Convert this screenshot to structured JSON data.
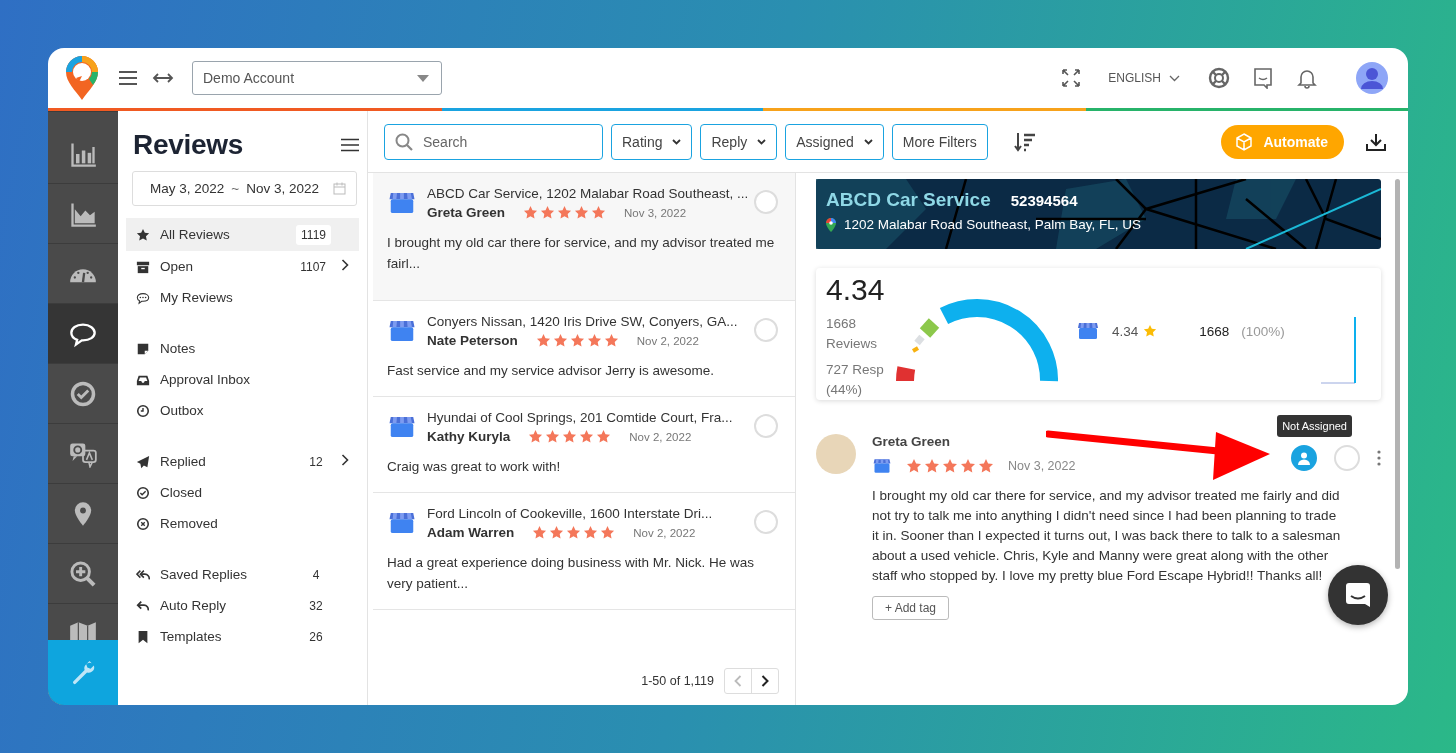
{
  "header": {
    "account_select": "Demo Account",
    "language": "ENGLISH"
  },
  "rail": [
    {
      "selected": false
    },
    {
      "selected": false
    },
    {
      "selected": false
    },
    {
      "selected": true
    },
    {
      "selected": false
    },
    {
      "selected": false
    },
    {
      "selected": false
    },
    {
      "selected": false
    },
    {
      "selected": false
    }
  ],
  "rail_footer": {
    "selected": true
  },
  "sidebar": {
    "title": "Reviews",
    "date_range": {
      "start": "May 3, 2022",
      "separator": "~",
      "end": "Nov 3, 2022"
    },
    "groups": [
      {
        "items": [
          {
            "label": "All Reviews",
            "count": "1119",
            "selected": true,
            "expandable": false
          },
          {
            "label": "Open",
            "count": "1107",
            "selected": false,
            "expandable": true
          },
          {
            "label": "My Reviews",
            "selected": false,
            "expandable": false
          }
        ]
      },
      {
        "items": [
          {
            "label": "Notes",
            "selected": false,
            "expandable": false
          },
          {
            "label": "Approval Inbox",
            "selected": false,
            "expandable": false
          },
          {
            "label": "Outbox",
            "selected": false,
            "expandable": false
          }
        ]
      },
      {
        "items": [
          {
            "label": "Replied",
            "count": "12",
            "selected": false,
            "expandable": true
          },
          {
            "label": "Closed",
            "selected": false,
            "expandable": false
          },
          {
            "label": "Removed",
            "selected": false,
            "expandable": false
          }
        ]
      },
      {
        "items": [
          {
            "label": "Saved Replies",
            "count": "4",
            "selected": false,
            "expandable": false
          },
          {
            "label": "Auto Reply",
            "count": "32",
            "selected": false,
            "expandable": false
          },
          {
            "label": "Templates",
            "count": "26",
            "selected": false,
            "expandable": false
          }
        ]
      }
    ]
  },
  "toolbar": {
    "search": {
      "placeholder": "Search"
    },
    "dropdowns": [
      "Rating",
      "Reply",
      "Assigned"
    ],
    "more_filters": "More Filters",
    "automate": "Automate"
  },
  "reviews": [
    {
      "location": "ABCD Car Service, 1202 Malabar Road Southeast, ...",
      "author": "Greta Green",
      "stars": 5,
      "date": "Nov 3, 2022",
      "excerpt": "I brought my old car there for service, and my advisor treated me fairl...",
      "selected": true,
      "checked": false
    },
    {
      "location": "Conyers Nissan, 1420 Iris Drive SW, Conyers, GA...",
      "author": "Nate Peterson",
      "stars": 5,
      "date": "Nov 2, 2022",
      "excerpt": "Fast service and my service advisor Jerry is awesome.",
      "selected": false,
      "checked": false
    },
    {
      "location": "Hyundai of Cool Springs, 201 Comtide Court, Fra...",
      "author": "Kathy Kuryla",
      "stars": 5,
      "date": "Nov 2, 2022",
      "excerpt": "Craig was great to work with!",
      "selected": false,
      "checked": false
    },
    {
      "location": "Ford Lincoln of Cookeville, 1600 Interstate Dri...",
      "author": "Adam Warren",
      "stars": 5,
      "date": "Nov 2, 2022",
      "excerpt": "Had a great experience doing business with Mr. Nick. He was very patient...",
      "selected": false,
      "checked": false
    }
  ],
  "pagination": {
    "range": "1-50 of 1,119"
  },
  "detail": {
    "business": {
      "name": "ABCD Car Service",
      "id": "52394564",
      "address": "1202 Malabar Road Southeast, Palm Bay, FL, US"
    },
    "stats": {
      "rating": "4.34",
      "review_count": "1668",
      "review_label": "Reviews",
      "responses": "727 Resp",
      "response_share": "(44%)",
      "source_rating": "4.34",
      "source_count": "1668",
      "source_share": "(100%)"
    },
    "review": {
      "author": "Greta Green",
      "stars": 5,
      "date": "Nov 3, 2022",
      "text": "I brought my old car there for service, and my advisor treated me fairly and did not try to talk me into anything I didn't need since I had been planning to trade it in. Sooner than I expected it turns out, I was back there to talk to a salesman about a used vehicle. Chris, Kyle and Manny were great along with the other staff who stopped by. I love my pretty blue Ford Escape Hybrid!! Thanks all!",
      "assigned": false,
      "checked": false,
      "tooltip": "Not Assigned",
      "add_tag": "+ Add tag"
    }
  }
}
